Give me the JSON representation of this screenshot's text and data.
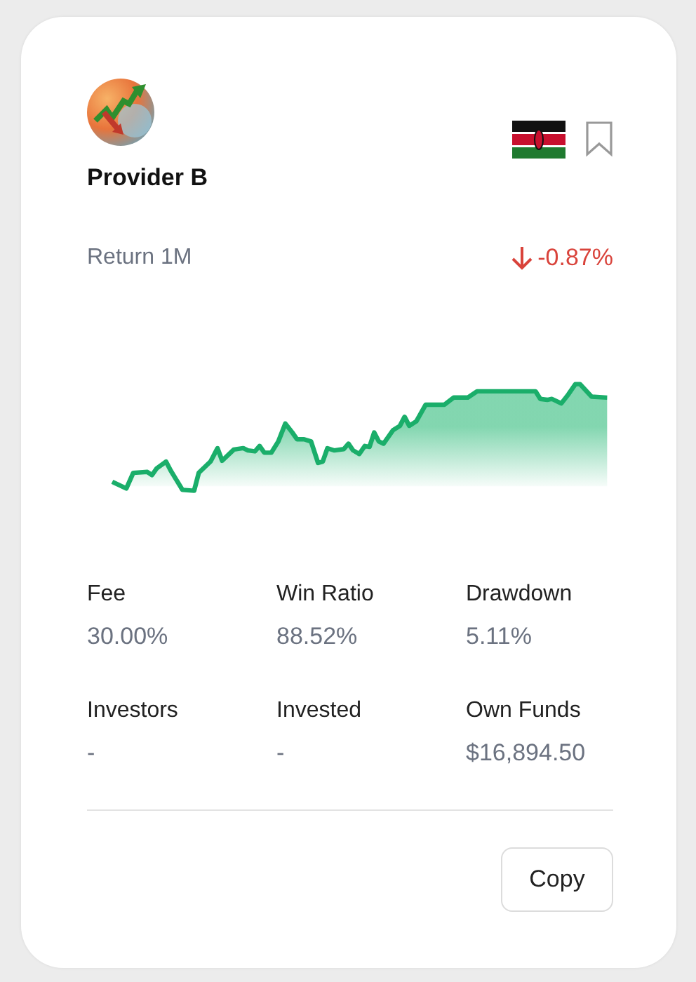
{
  "provider": {
    "name": "Provider B",
    "bookmarked": false
  },
  "return": {
    "label": "Return 1M",
    "value": "-0.87%",
    "falling": true
  },
  "stats": [
    {
      "label": "Fee",
      "value": "30.00%"
    },
    {
      "label": "Win Ratio",
      "value": "88.52%"
    },
    {
      "label": "Drawdown",
      "value": "5.11%"
    },
    {
      "label": "Investors",
      "value": "-"
    },
    {
      "label": "Invested",
      "value": "-"
    },
    {
      "label": "Own Funds",
      "value": "$16,894.50"
    }
  ],
  "buttons": [
    "Copy"
  ]
}
